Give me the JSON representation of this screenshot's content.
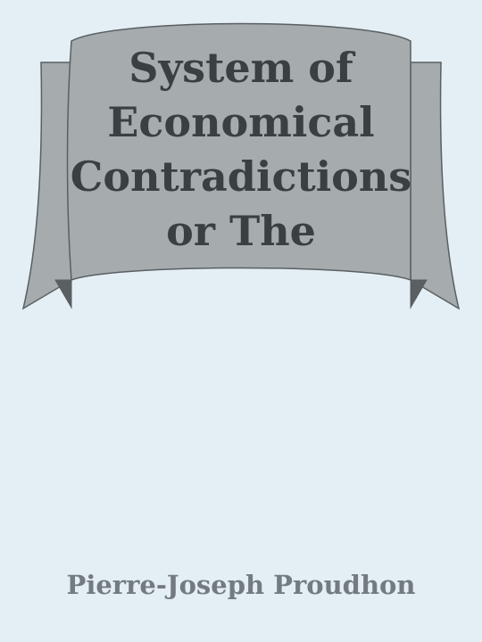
{
  "cover": {
    "title_lines": [
      "System of",
      "Economical",
      "Contradictions",
      "or The"
    ],
    "author": "Pierre-Joseph Proudhon",
    "colors": {
      "background": "#e4eff5",
      "banner_fill": "#a6abad",
      "banner_shadow": "#5a5f62",
      "title_text": "#3a3f42",
      "author_text": "#737b80"
    }
  }
}
